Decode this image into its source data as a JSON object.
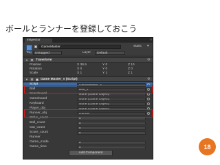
{
  "slide": {
    "title": "ボールとランナーを登録しておこう",
    "page_number": "18"
  },
  "inspector": {
    "tab_label": "Inspector",
    "object_name": "GameMaster",
    "static_label": "Static",
    "static_arrow": "▾",
    "tag_label": "Tag",
    "tag_value": "Untagged",
    "layer_label": "Layer",
    "layer_value": "Default",
    "transform": {
      "title": "Transform",
      "rows": [
        {
          "label": "Position",
          "x": "X 36.5",
          "y": "Y 0",
          "z": "Z 10"
        },
        {
          "label": "Rotation",
          "x": "X 0",
          "y": "Y 0",
          "z": "Z 0"
        },
        {
          "label": "Scale",
          "x": "X 1",
          "y": "Y 1",
          "z": "Z 1"
        }
      ]
    },
    "script_component": {
      "title": "Game Master_v (Script)",
      "fields": [
        {
          "label": "Script",
          "value": "GameMaster_v"
        },
        {
          "label": "Ball",
          "value": "Ball_1"
        },
        {
          "label": "Scoreboard",
          "value": "None (Game Object)"
        },
        {
          "label": "Gameboard",
          "value": "None (Game Object)"
        },
        {
          "label": "Keyboard",
          "value": "None (Game Object)"
        },
        {
          "label": "Player_obj",
          "value": "None (Game Object)"
        },
        {
          "label": "Runner_obj",
          "value": "Runner"
        },
        {
          "label": "Strike_count",
          "value": "0"
        },
        {
          "label": "Ball_count",
          "value": "0"
        },
        {
          "label": "Out_count",
          "value": "0"
        },
        {
          "label": "Score_count",
          "value": "0"
        },
        {
          "label": "Runner",
          "value": ""
        },
        {
          "label": "Game_mode",
          "value": "0"
        },
        {
          "label": "Game_time",
          "value": "0"
        }
      ]
    },
    "add_component_label": "Add Component"
  },
  "colors": {
    "accent": "#e87522",
    "highlight": "#d81b1b",
    "selection": "#3d6aa4",
    "panel": "#383838"
  },
  "icons": {
    "object": "cube-icon",
    "settings": "gear-icon",
    "fold": "triangle-down-icon",
    "object_picker": "circle-picker-icon"
  }
}
